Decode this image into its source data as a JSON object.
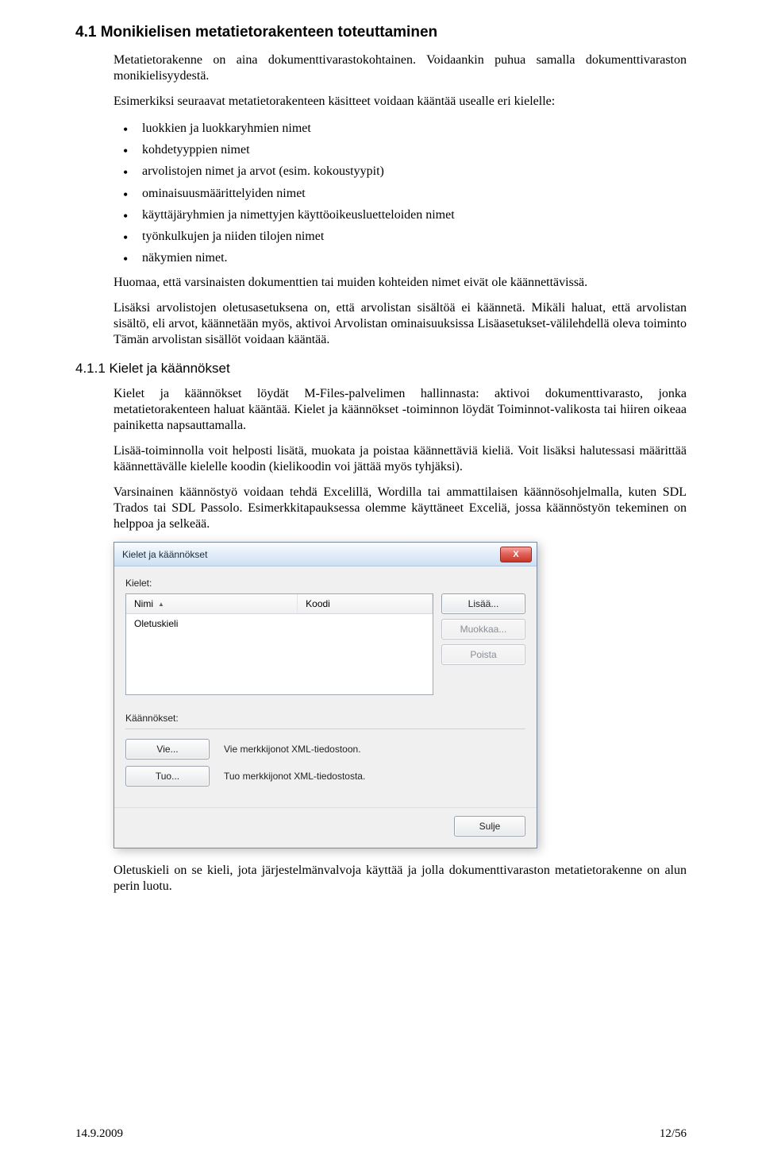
{
  "section": {
    "num_title": "4.1 Monikielisen metatietorakenteen toteuttaminen",
    "p1": "Metatietorakenne on aina dokumenttivarastokohtainen. Voidaankin puhua samalla dokumenttivaraston monikielisyydestä.",
    "p2": "Esimerkiksi seuraavat metatietorakenteen käsitteet voidaan kääntää usealle eri kielelle:",
    "bullets": [
      "luokkien ja luokkaryhmien nimet",
      "kohdetyyppien nimet",
      "arvolistojen nimet ja arvot (esim. kokoustyypit)",
      "ominaisuusmäärittelyiden nimet",
      "käyttäjäryhmien ja nimettyjen käyttöoikeusluetteloiden nimet",
      "työnkulkujen ja niiden tilojen nimet",
      "näkymien nimet."
    ],
    "p3": "Huomaa, että varsinaisten dokumenttien tai muiden kohteiden nimet eivät ole käännettävissä.",
    "p4": "Lisäksi arvolistojen oletusasetuksena on, että arvolistan sisältöä ei käännetä. Mikäli haluat, että arvolistan sisältö, eli arvot, käännetään myös, aktivoi Arvolistan ominaisuuksissa Lisäasetukset-välilehdellä oleva toiminto Tämän arvolistan sisällöt voidaan kääntää."
  },
  "subsection": {
    "num_title": "4.1.1 Kielet ja käännökset",
    "p1": "Kielet ja käännökset löydät M-Files-palvelimen hallinnasta: aktivoi dokumenttivarasto, jonka metatietorakenteen haluat kääntää. Kielet ja käännökset -toiminnon löydät Toiminnot-valikosta tai hiiren oikeaa painiketta napsauttamalla.",
    "p2": "Lisää-toiminnolla voit helposti lisätä, muokata ja poistaa käännettäviä kieliä. Voit lisäksi halutessasi määrittää käännettävälle kielelle koodin (kielikoodin voi jättää myös tyhjäksi).",
    "p3": "Varsinainen käännöstyö voidaan tehdä Excelillä, Wordilla tai ammattilaisen käännösohjelmalla, kuten SDL Trados tai SDL Passolo. Esimerkkitapauksessa olemme käyttäneet Exceliä, jossa käännöstyön tekeminen on helppoa ja selkeää.",
    "p_after": "Oletuskieli on se kieli, jota järjestelmänvalvoja käyttää ja jolla dokumenttivaraston metatietorakenne on alun perin luotu."
  },
  "dialog": {
    "title": "Kielet ja käännökset",
    "close_icon": "X",
    "languages_label": "Kielet:",
    "col_name": "Nimi",
    "col_code": "Koodi",
    "row1": "Oletuskieli",
    "btn_add": "Lisää...",
    "btn_edit": "Muokkaa...",
    "btn_delete": "Poista",
    "translations_label": "Käännökset:",
    "btn_export": "Vie...",
    "export_desc": "Vie merkkijonot XML-tiedostoon.",
    "btn_import": "Tuo...",
    "import_desc": "Tuo merkkijonot XML-tiedostosta.",
    "btn_close": "Sulje"
  },
  "footer": {
    "date": "14.9.2009",
    "page": "12/56"
  }
}
